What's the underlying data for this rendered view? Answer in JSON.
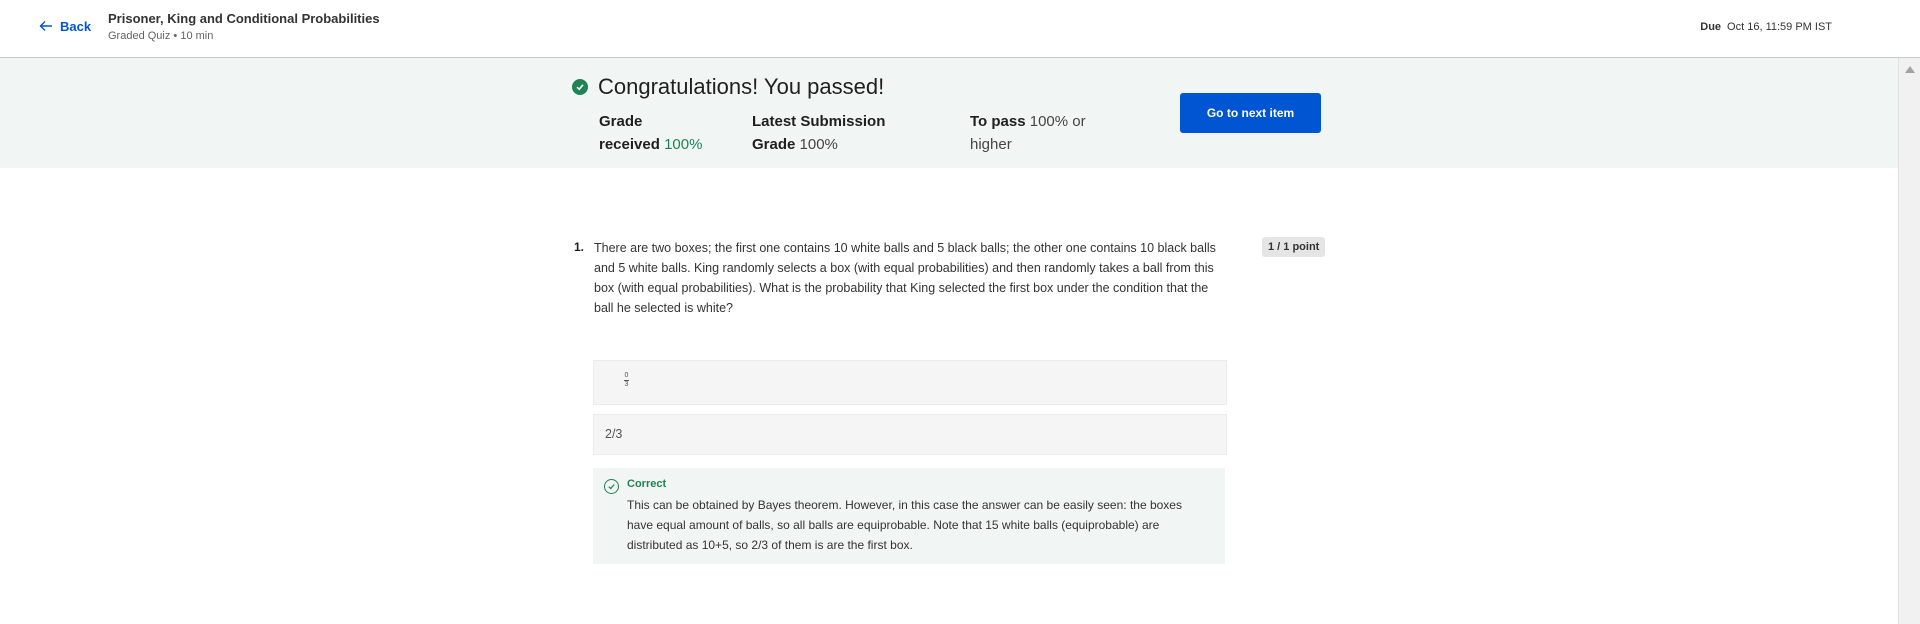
{
  "header": {
    "back_label": "Back",
    "quiz_title": "Prisoner, King and Conditional Probabilities",
    "quiz_subtitle": "Graded Quiz • 10 min",
    "due_label": "Due",
    "due_value": "Oct 16, 11:59 PM IST"
  },
  "banner": {
    "message": "Congratulations! You passed!",
    "grade_label_1": "Grade",
    "grade_label_2": "received",
    "grade_value": "100%",
    "latest_label_1": "Latest Submission",
    "latest_label_2": "Grade",
    "latest_value": "100%",
    "pass_label": "To pass",
    "pass_value": "100% or",
    "pass_value_2": "higher",
    "next_button": "Go to next item",
    "accent_color": "#1f8354",
    "button_color": "#0056d2"
  },
  "question": {
    "number": "1.",
    "text": "There are two boxes; the first one contains 10 white balls and 5 black balls; the other one contains 10 black balls and 5 white balls. King randomly selects a box (with equal probabilities) and then randomly takes a ball from this box (with equal probabilities). What  is the probability that King selected the first box under the condition that the ball he selected is white?",
    "points": "1 / 1 point",
    "option_1_numerator": "0",
    "option_1_denominator": "3",
    "option_2": "2/3",
    "feedback_label": "Correct",
    "feedback_text": "This can be obtained by Bayes theorem. However, in this case the answer can be easily seen: the boxes have equal amount of balls, so all balls are equiprobable. Note that 15 white balls (equiprobable) are distributed as 10+5, so 2/3 of them is are the first box."
  }
}
